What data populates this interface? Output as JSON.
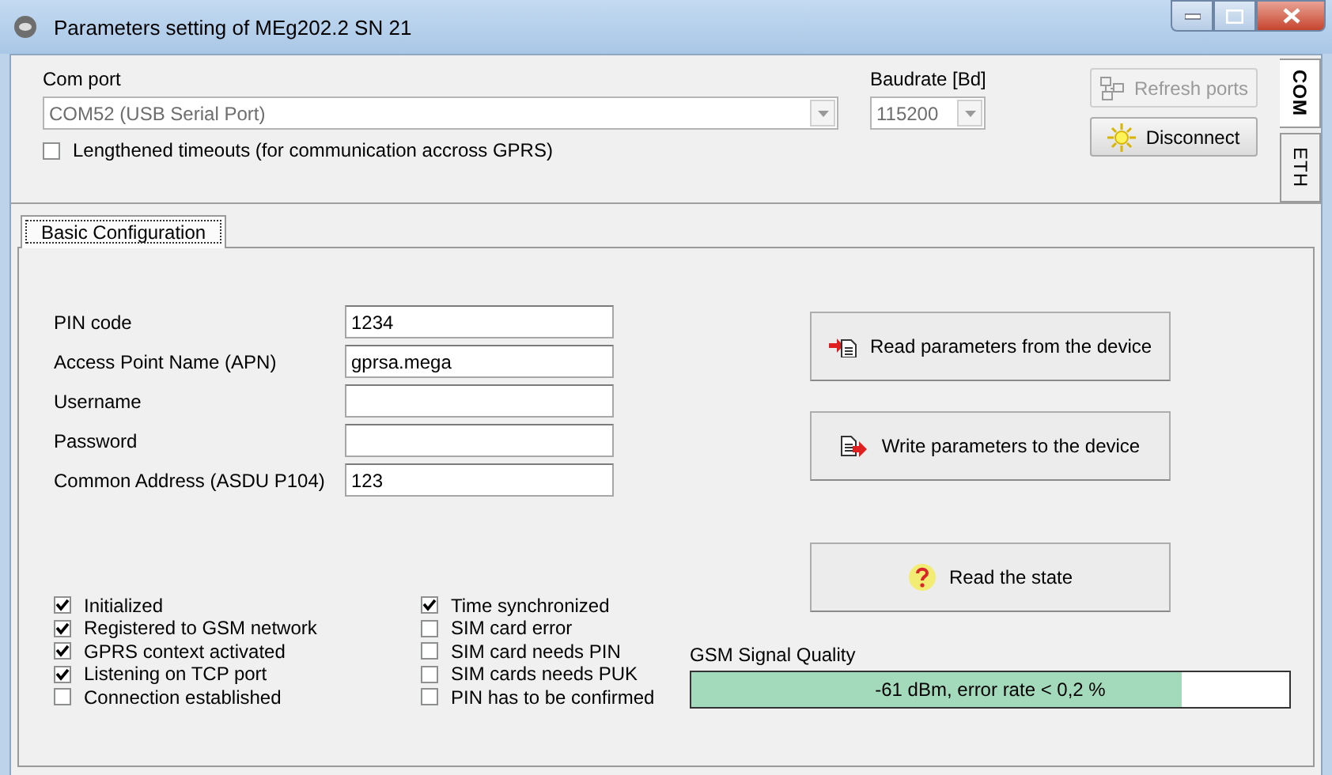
{
  "window": {
    "title": "Parameters setting of MEg202.2 SN 21"
  },
  "connection": {
    "port_label": "Com port",
    "port_value": "COM52 (USB Serial Port)",
    "port_disabled": true,
    "baud_label": "Baudrate [Bd]",
    "baud_value": "115200",
    "baud_disabled": true,
    "timeouts": {
      "label": "Lengthened timeouts (for communication accross GPRS)",
      "checked": false
    },
    "buttons": [
      {
        "label": "Refresh ports",
        "kind": "refresh",
        "disabled": true
      },
      {
        "label": "Disconnect",
        "kind": "disconnect",
        "disabled": false
      }
    ]
  },
  "side_tabs": [
    {
      "label": "COM",
      "selected": true
    },
    {
      "label": "ETH",
      "selected": false
    }
  ],
  "tabs": [
    {
      "label": "Basic Configuration",
      "selected": true
    }
  ],
  "fields": [
    {
      "label": "PIN code",
      "value": "1234"
    },
    {
      "label": "Access Point Name (APN)",
      "value": "gprsa.mega"
    },
    {
      "label": "Username"
    },
    {
      "label": "Password"
    },
    {
      "label": "Common Address (ASDU P104)",
      "value": "123"
    }
  ],
  "actions": [
    {
      "label": "Read parameters from the device",
      "kind": "read"
    },
    {
      "label": "Write parameters to the device",
      "kind": "write"
    },
    {
      "label": "Read the state",
      "kind": "state"
    }
  ],
  "status_columns": [
    {
      "items": [
        {
          "label": "Initialized",
          "checked": true
        },
        {
          "label": "Registered to GSM network",
          "checked": true
        },
        {
          "label": "GPRS context activated",
          "checked": true
        },
        {
          "label": "Listening on TCP port",
          "checked": true
        },
        {
          "label": "Connection established",
          "checked": false
        }
      ]
    },
    {
      "items": [
        {
          "label": "Time synchronized",
          "checked": true
        },
        {
          "label": "SIM card error",
          "checked": false
        },
        {
          "label": "SIM card needs PIN",
          "checked": false
        },
        {
          "label": "SIM cards needs PUK",
          "checked": false
        },
        {
          "label": "PIN has to be confirmed",
          "checked": false
        }
      ]
    }
  ],
  "signal": {
    "label": "GSM Signal Quality",
    "reading": "-61 dBm, error rate < 0,2 %",
    "level": 0.82
  }
}
